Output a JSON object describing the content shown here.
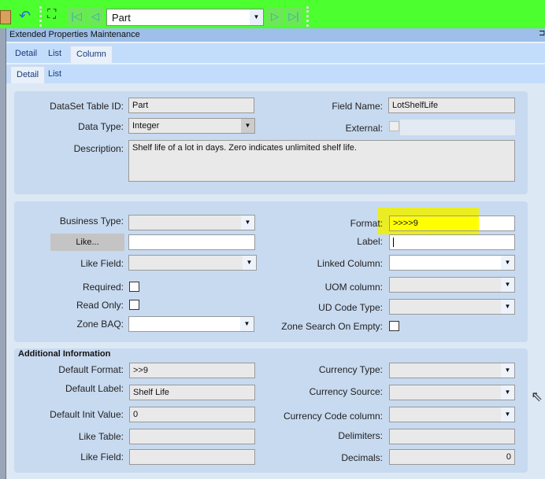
{
  "toolbar": {
    "combo_value": "Part",
    "icons": [
      "clipboard-icon",
      "undo-icon",
      "binoculars-icon",
      "first-record-icon",
      "previous-record-icon",
      "next-record-icon",
      "last-record-icon"
    ]
  },
  "window": {
    "title": "Extended Properties Maintenance"
  },
  "tabs": [
    "Detail",
    "List",
    "Column"
  ],
  "subtabs": [
    "Detail",
    "List"
  ],
  "panel1": {
    "dataset_label": "DataSet Table ID:",
    "dataset_value": "Part",
    "field_name_label": "Field Name:",
    "field_name_value": "LotShelfLife",
    "data_type_label": "Data Type:",
    "data_type_value": "Integer",
    "external_label": "External:",
    "description_label": "Description:",
    "description_value": "Shelf life of a lot in days.  Zero indicates unlimited shelf life."
  },
  "panel2": {
    "business_type_label": "Business Type:",
    "like_button": "Like...",
    "like_field_label": "Like Field:",
    "required_label": "Required:",
    "read_only_label": "Read Only:",
    "zone_baq_label": "Zone BAQ:",
    "format_label": "Format:",
    "format_value": ">>>>9",
    "label_label": "Label:",
    "label_value": "",
    "linked_column_label": "Linked Column:",
    "uom_column_label": "UOM column:",
    "ud_code_type_label": "UD Code Type:",
    "zone_search_label": "Zone Search On Empty:"
  },
  "panel3": {
    "title": "Additional Information",
    "default_format_label": "Default Format:",
    "default_format_value": ">>9",
    "default_label_label": "Default Label:",
    "default_label_value": "Shelf Life",
    "default_init_label": "Default Init Value:",
    "default_init_value": "0",
    "like_table_label": "Like Table:",
    "like_field_label": "Like Field:",
    "currency_type_label": "Currency Type:",
    "currency_source_label": "Currency Source:",
    "currency_code_label": "Currency Code column:",
    "delimiters_label": "Delimiters:",
    "decimals_label": "Decimals:",
    "decimals_value": "0"
  },
  "colors": {
    "toolbar": "#4cff2e",
    "highlight": "#ffff00",
    "panel": "#c8daf0"
  }
}
